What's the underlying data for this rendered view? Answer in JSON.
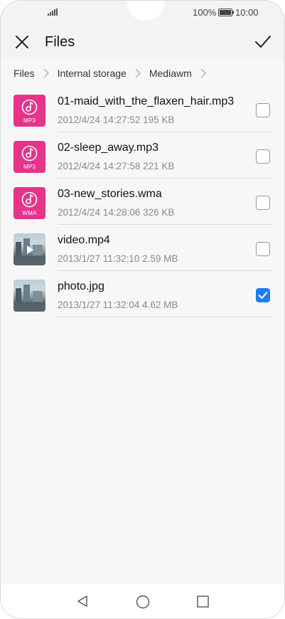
{
  "status_bar": {
    "battery_percent": "100%",
    "time": "10:00"
  },
  "app_bar": {
    "title": "Files"
  },
  "breadcrumb": [
    "Files",
    "Internal storage",
    "Mediawm"
  ],
  "files": [
    {
      "name": "01-maid_with_the_flaxen_hair.mp3",
      "meta": "2012/4/24 14:27:52 195 KB",
      "type_label": "MP3",
      "kind": "audio",
      "checked": false
    },
    {
      "name": "02-sleep_away.mp3",
      "meta": "2012/4/24 14:27:58 221 KB",
      "type_label": "MP3",
      "kind": "audio",
      "checked": false
    },
    {
      "name": "03-new_stories.wma",
      "meta": "2012/4/24 14:28:06 326 KB",
      "type_label": "WMA",
      "kind": "audio",
      "checked": false
    },
    {
      "name": "video.mp4",
      "meta": "2013/1/27 11:32:10 2.59 MB",
      "kind": "video",
      "checked": false
    },
    {
      "name": "photo.jpg",
      "meta": "2013/1/27 11:32:04 4.62 MB",
      "kind": "image",
      "checked": true
    }
  ],
  "colors": {
    "audio_tile": "#e8338a",
    "accent": "#1f7cf5"
  },
  "icons": [
    "close-icon",
    "check-icon",
    "music-note-icon",
    "play-icon",
    "back-triangle-icon",
    "home-circle-icon",
    "recent-square-icon"
  ]
}
